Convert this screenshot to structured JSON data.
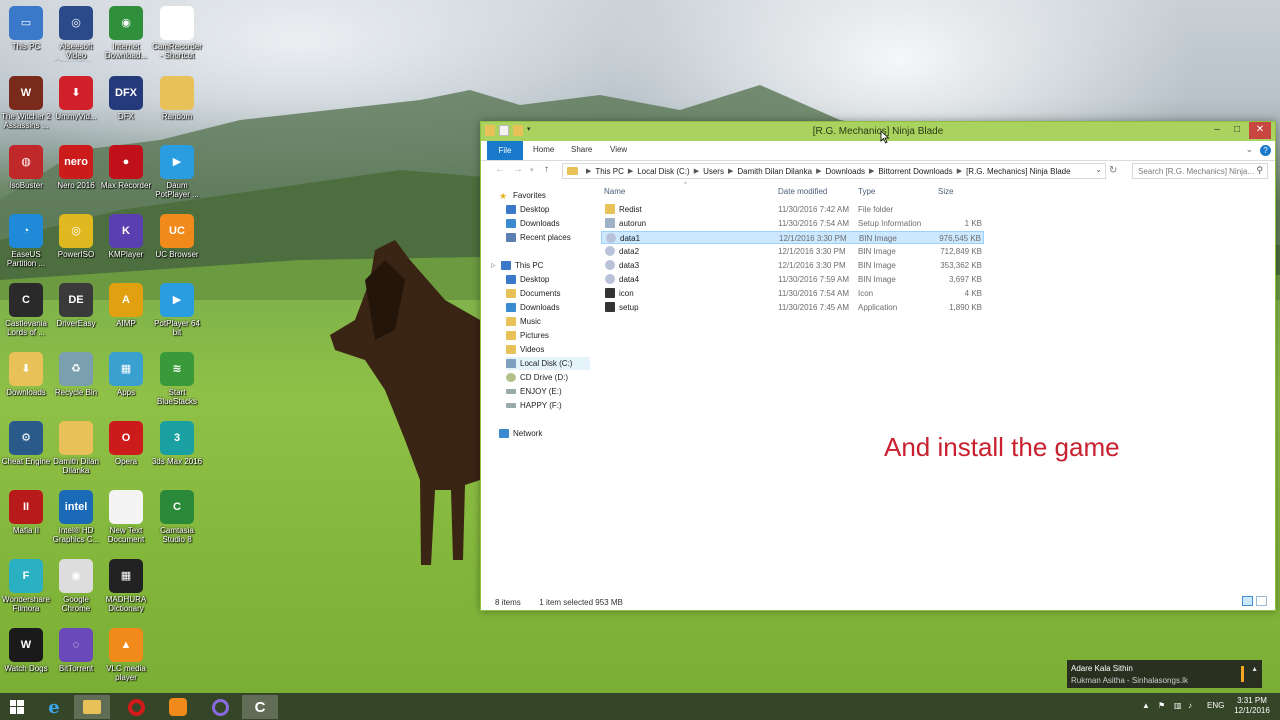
{
  "desktop_icons": [
    {
      "label": "This PC",
      "bg": "#3a78c9",
      "glyph": "▭"
    },
    {
      "label": "Aiseesoft Video Converter...",
      "bg": "#2a4a8a",
      "glyph": "◎"
    },
    {
      "label": "Internet Download...",
      "bg": "#2f8f3a",
      "glyph": "◉"
    },
    {
      "label": "CamRecorder - Shortcut",
      "bg": "#ffffff",
      "glyph": "C"
    },
    {
      "label": "The Witcher 2 Assassins ...",
      "bg": "#7a2a1a",
      "glyph": "W"
    },
    {
      "label": "UmmyVid...",
      "bg": "#d0202a",
      "glyph": "⬇"
    },
    {
      "label": "DFX",
      "bg": "#243a7a",
      "glyph": "DFX"
    },
    {
      "label": "Random",
      "bg": "#e8c158",
      "glyph": ""
    },
    {
      "label": "IsoBuster",
      "bg": "#c0282a",
      "glyph": "◍"
    },
    {
      "label": "Nero 2016",
      "bg": "#cc1b1b",
      "glyph": "nero"
    },
    {
      "label": "Max Recorder",
      "bg": "#c0101a",
      "glyph": "●"
    },
    {
      "label": "Daum PotPlayer ...",
      "bg": "#2a9de0",
      "glyph": "▶"
    },
    {
      "label": "EaseUS Partition ...",
      "bg": "#1f8ad8",
      "glyph": "◔"
    },
    {
      "label": "PowerISO",
      "bg": "#e0b820",
      "glyph": "◎"
    },
    {
      "label": "KMPlayer",
      "bg": "#5a3fb0",
      "glyph": "K"
    },
    {
      "label": "UC Browser",
      "bg": "#f08a1a",
      "glyph": "UC"
    },
    {
      "label": "Castlevania Lords of ...",
      "bg": "#2a2a2a",
      "glyph": "C"
    },
    {
      "label": "DriverEasy",
      "bg": "#3a3a3a",
      "glyph": "DE"
    },
    {
      "label": "AIMP",
      "bg": "#e0a010",
      "glyph": "A"
    },
    {
      "label": "PotPlayer 64 bit",
      "bg": "#2a9de0",
      "glyph": "▶"
    },
    {
      "label": "Downloads",
      "bg": "#e8c158",
      "glyph": "⬇"
    },
    {
      "label": "Recycle Bin",
      "bg": "#7aa0b0",
      "glyph": "♻"
    },
    {
      "label": "Apps",
      "bg": "#3aa0d0",
      "glyph": "▦"
    },
    {
      "label": "Start BlueStacks",
      "bg": "#3a9a3a",
      "glyph": "≋"
    },
    {
      "label": "Cheat Engine",
      "bg": "#2a5a8a",
      "glyph": "⚙"
    },
    {
      "label": "Damith Dilan Dilanka",
      "bg": "#e8c158",
      "glyph": ""
    },
    {
      "label": "Opera",
      "bg": "#cc1b1b",
      "glyph": "O"
    },
    {
      "label": "3ds Max 2016",
      "bg": "#1aa0a0",
      "glyph": "3"
    },
    {
      "label": "Mafia II",
      "bg": "#b81a1a",
      "glyph": "II"
    },
    {
      "label": "Intel® HD Graphics C...",
      "bg": "#1a6ab8",
      "glyph": "intel"
    },
    {
      "label": "New Text Document",
      "bg": "#f4f4f4",
      "glyph": ""
    },
    {
      "label": "Camtasia Studio 8",
      "bg": "#2a8a3a",
      "glyph": "C"
    },
    {
      "label": "Wondershare Filmora",
      "bg": "#2ab0c0",
      "glyph": "F"
    },
    {
      "label": "Google Chrome",
      "bg": "#dddddd",
      "glyph": "◉"
    },
    {
      "label": "MADHURA Dictionary",
      "bg": "#222222",
      "glyph": "▦"
    },
    {
      "label": "",
      "bg": "rgba(0,0,0,0)",
      "glyph": ""
    },
    {
      "label": "Watch Dogs",
      "bg": "#1a1a1a",
      "glyph": "W"
    },
    {
      "label": "BitTorrent",
      "bg": "#6a4ab8",
      "glyph": "◌"
    },
    {
      "label": "VLC media player",
      "bg": "#f08a1a",
      "glyph": "▲"
    }
  ],
  "window": {
    "title": "[R.G. Mechanics] Ninja Blade",
    "minimize": "–",
    "maximize": "□",
    "close": "✕",
    "ribbon_tabs": [
      "File",
      "Home",
      "Share",
      "View"
    ],
    "help": "?",
    "address": {
      "crumbs": [
        "This PC",
        "Local Disk (C:)",
        "Users",
        "Damith Dilan Dilanka",
        "Downloads",
        "Bittorrent Downloads",
        "[R.G. Mechanics] Ninja Blade"
      ],
      "dropdown": "⌄"
    },
    "search_placeholder": "Search [R.G. Mechanics] Ninja...",
    "nav": {
      "favorites_header": "Favorites",
      "favorites": [
        "Desktop",
        "Downloads",
        "Recent places"
      ],
      "thispc_header": "This PC",
      "thispc": [
        "Desktop",
        "Documents",
        "Downloads",
        "Music",
        "Pictures",
        "Videos",
        "Local Disk (C:)",
        "CD Drive (D:)",
        "ENJOY (E:)",
        "HAPPY (F:)"
      ],
      "network": "Network"
    },
    "columns": {
      "name": "Name",
      "date": "Date modified",
      "type": "Type",
      "size": "Size"
    },
    "files": [
      {
        "name": "Redist",
        "date": "11/30/2016 7:42 AM",
        "type": "File folder",
        "size": "",
        "icon": "folder",
        "color": "#e8c158"
      },
      {
        "name": "autorun",
        "date": "11/30/2016 7:54 AM",
        "type": "Setup Information",
        "size": "1 KB",
        "icon": "setup-info",
        "color": "#9fb2c8"
      },
      {
        "name": "data1",
        "date": "12/1/2016 3:30 PM",
        "type": "BIN Image",
        "size": "976,545 KB",
        "icon": "disc",
        "color": "#b8c2d8"
      },
      {
        "name": "data2",
        "date": "12/1/2016 3:30 PM",
        "type": "BIN Image",
        "size": "712,849 KB",
        "icon": "disc",
        "color": "#b8c2d8"
      },
      {
        "name": "data3",
        "date": "12/1/2016 3:30 PM",
        "type": "BIN Image",
        "size": "353,362 KB",
        "icon": "disc",
        "color": "#b8c2d8"
      },
      {
        "name": "data4",
        "date": "11/30/2016 7:59 AM",
        "type": "BIN Image",
        "size": "3,697 KB",
        "icon": "disc",
        "color": "#b8c2d8"
      },
      {
        "name": "icon",
        "date": "11/30/2016 7:54 AM",
        "type": "Icon",
        "size": "4 KB",
        "icon": "icon-file",
        "color": "#333333"
      },
      {
        "name": "setup",
        "date": "11/30/2016 7:45 AM",
        "type": "Application",
        "size": "1,890 KB",
        "icon": "app",
        "color": "#333333"
      }
    ],
    "status_items": "8 items",
    "status_selected": "1 item selected  953 MB"
  },
  "caption": "And install the game",
  "notification": {
    "title": "Adare Kala Sithin",
    "subtitle": "Rukman Asitha - Sinhalasongs.lk",
    "expand": "▲"
  },
  "taskbar": {
    "language": "ENG",
    "time": "3:31 PM",
    "date": "12/1/2016"
  },
  "colors": {
    "accent": "#1979ca",
    "titlebar": "#a9d35e",
    "selection": "#cce8ff",
    "caption": "#c8202e"
  }
}
